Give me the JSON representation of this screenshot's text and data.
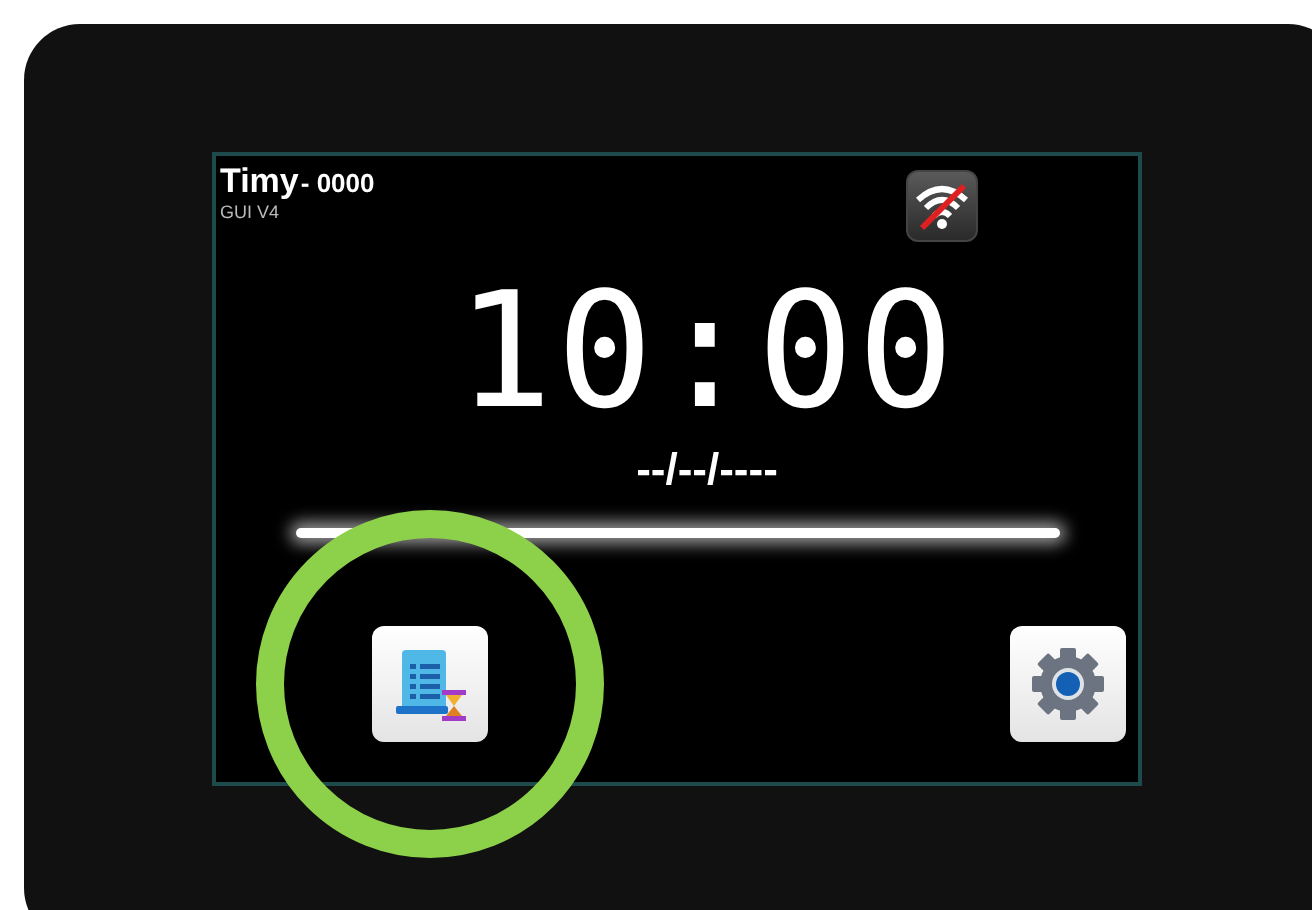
{
  "header": {
    "device_name": "Timy",
    "device_id": "- 0000",
    "version": "GUI V4"
  },
  "wifi": {
    "connected": false
  },
  "clock": {
    "time": "10:00",
    "date": "--/--/----"
  },
  "buttons": [
    {
      "kind": "log",
      "highlighted": true
    },
    {
      "kind": "settings",
      "highlighted": false
    }
  ]
}
